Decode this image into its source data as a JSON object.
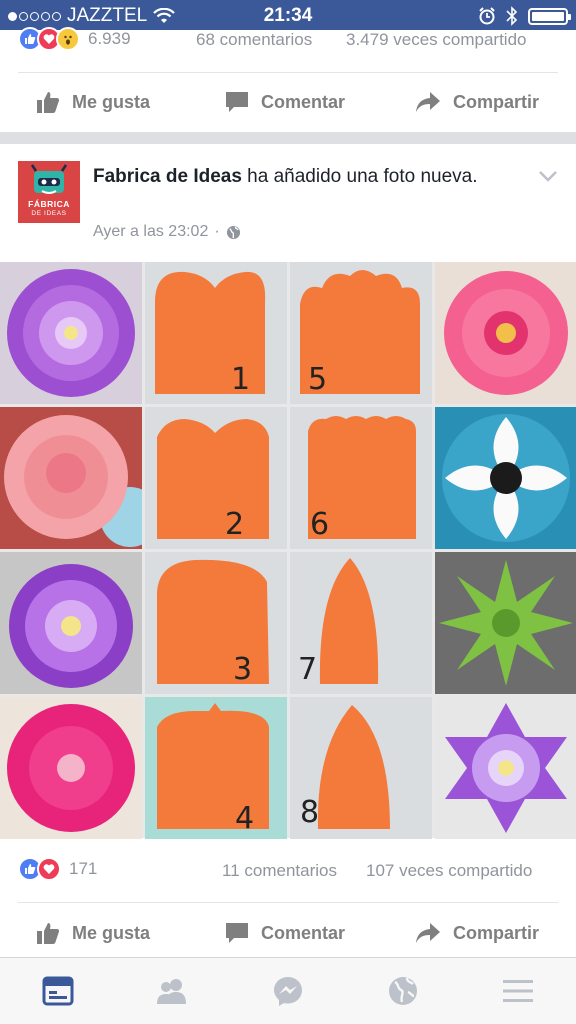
{
  "status_bar": {
    "carrier": "JAZZTEL",
    "time": "21:34",
    "icons": [
      "signal-dots",
      "wifi-icon",
      "alarm-icon",
      "bluetooth-icon",
      "battery-icon"
    ]
  },
  "previous_post": {
    "reactions": [
      "like",
      "love",
      "wow"
    ],
    "reaction_count": "6.939",
    "comments": "68 comentarios",
    "shares": "3.479 veces compartido",
    "actions": {
      "like": "Me gusta",
      "comment": "Comentar",
      "share": "Compartir"
    }
  },
  "post": {
    "author": "Fabrica de Ideas",
    "action_text": " ha añadido una foto nueva.",
    "timestamp": "Ayer a las 23:02",
    "separator": "·",
    "privacy_icon": "globe-icon",
    "avatar": {
      "line1": "FÁBRICA",
      "line2": "DE IDEAS"
    },
    "photo": {
      "template_numbers": [
        "1",
        "5",
        "2",
        "6",
        "3",
        "7",
        "4",
        "8"
      ],
      "colors": {
        "orange": "#f47a3c",
        "pink": "#f4608f",
        "purple": "#b56be0",
        "teal": "#2a8fb4",
        "green": "#7fc142",
        "magenta": "#e8247a"
      }
    },
    "reactions": [
      "like",
      "love"
    ],
    "reaction_count": "171",
    "comments": "11 comentarios",
    "shares": "107 veces compartido",
    "actions": {
      "like": "Me gusta",
      "comment": "Comentar",
      "share": "Compartir"
    }
  },
  "tab_bar": {
    "tabs": [
      "news-feed-icon",
      "friends-icon",
      "messenger-icon",
      "notifications-globe-icon",
      "menu-icon"
    ],
    "active": "news-feed-icon",
    "active_color": "#3b5998",
    "inactive_color": "#bdc1c9"
  }
}
